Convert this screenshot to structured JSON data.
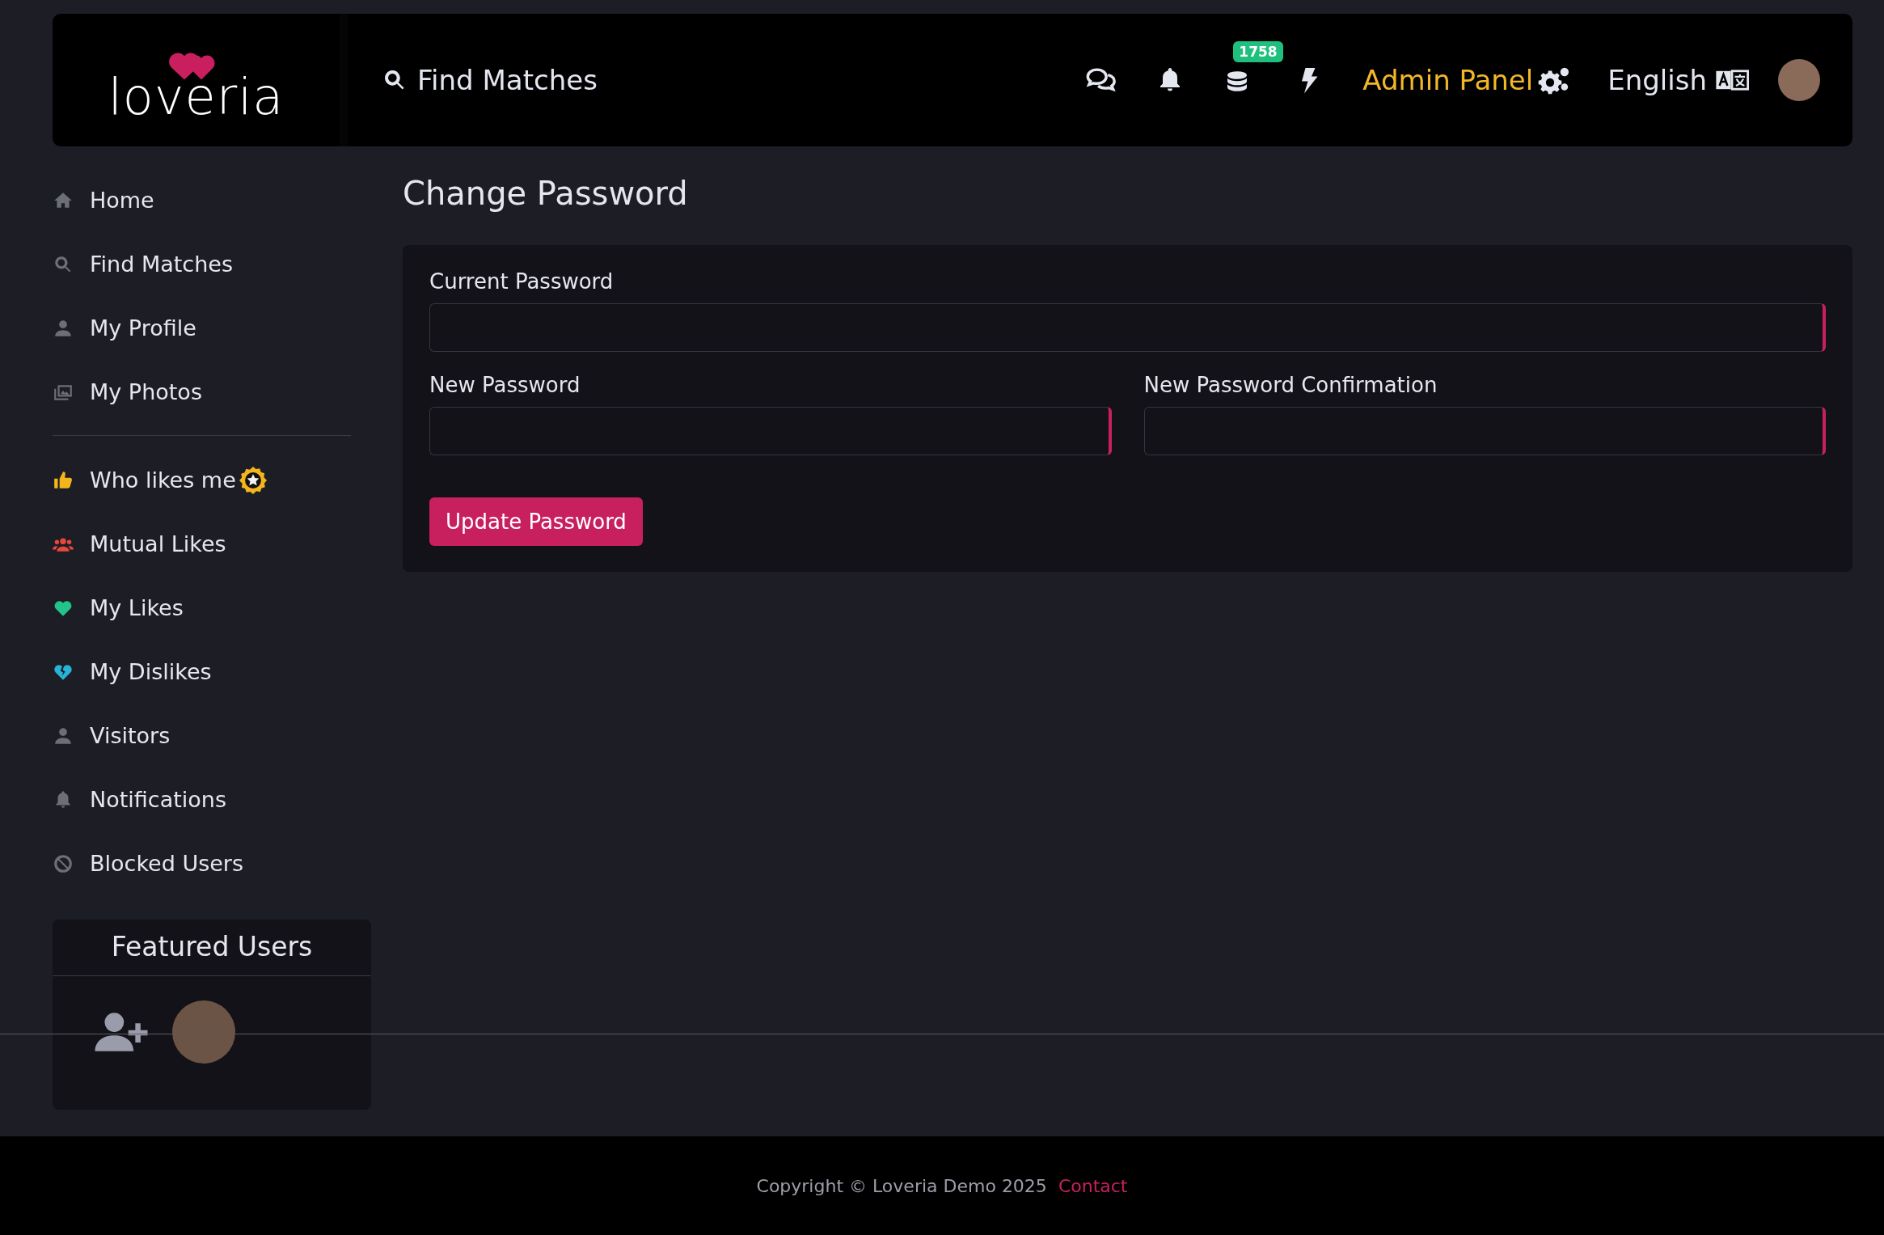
{
  "header": {
    "logo": "loveria",
    "search_link": "Find Matches",
    "coins_badge": "1758",
    "admin_link": "Admin Panel",
    "language": "English"
  },
  "sidebar": {
    "groups": [
      [
        {
          "label": "Home",
          "color": "#6c6e78"
        },
        {
          "label": "Find Matches",
          "color": "#6c6e78"
        },
        {
          "label": "My Profile",
          "color": "#6c6e78"
        },
        {
          "label": "My Photos",
          "color": "#6c6e78"
        }
      ],
      [
        {
          "label": "Who likes me",
          "color": "#f3b51b"
        },
        {
          "label": "Mutual Likes",
          "color": "#e8483b"
        },
        {
          "label": "My Likes",
          "color": "#22c48a"
        },
        {
          "label": "My Dislikes",
          "color": "#27b3d6"
        },
        {
          "label": "Visitors",
          "color": "#6c6e78"
        },
        {
          "label": "Notifications",
          "color": "#6c6e78"
        },
        {
          "label": "Blocked Users",
          "color": "#6c6e78"
        }
      ]
    ]
  },
  "featured": {
    "title": "Featured Users"
  },
  "page_title": "Change Password",
  "form": {
    "rows": [
      [
        {
          "label": "Current Password"
        }
      ],
      [
        {
          "label": "New Password"
        },
        {
          "label": "New Password Confirmation"
        }
      ]
    ],
    "button": "Update Password"
  },
  "footer": {
    "copyright": "Copyright © Loveria Demo 2025",
    "link": "Contact"
  }
}
